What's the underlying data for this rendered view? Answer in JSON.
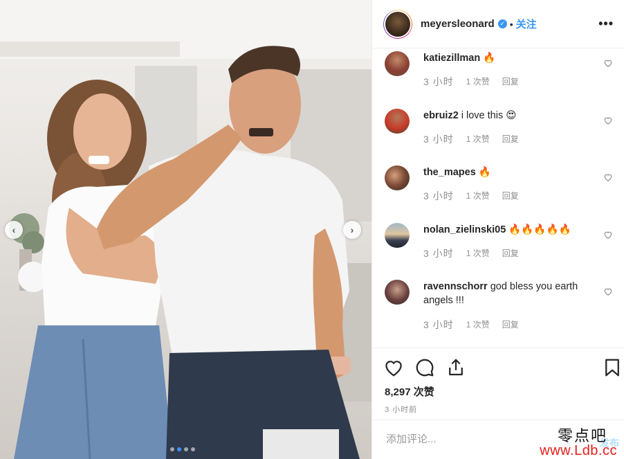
{
  "post": {
    "username": "meyersleonard",
    "verified_icon": "verified-badge-icon",
    "separator": "•",
    "follow_label": "关注",
    "more_label": "•••",
    "likes": "8,297 次赞",
    "posted_time": "3 小时前"
  },
  "comments": [
    {
      "user": "katiezillman",
      "text": "🔥",
      "time": "3 小时",
      "likes": "1 次赞",
      "reply": "回复"
    },
    {
      "user": "ebruiz2",
      "text": "i love this 😍",
      "time": "3 小时",
      "likes": "1 次赞",
      "reply": "回复"
    },
    {
      "user": "the_mapes",
      "text": "🔥",
      "time": "3 小时",
      "likes": "1 次赞",
      "reply": "回复"
    },
    {
      "user": "nolan_zielinski05",
      "text": "🔥🔥🔥🔥🔥",
      "time": "3 小时",
      "likes": "1 次赞",
      "reply": "回复"
    },
    {
      "user": "ravennschorr",
      "text": "god bless you earth angels !!!",
      "time": "3 小时",
      "likes": "1 次赞",
      "reply": "回复"
    }
  ],
  "add_comment": {
    "placeholder": "添加评论...",
    "publish_label": "发布"
  },
  "watermark": {
    "line1": "零点吧",
    "line2": "www.Ldb.cc"
  },
  "carousel": {
    "prev": "‹",
    "next": "›",
    "total_slides": 4,
    "active_slide": 2
  },
  "colors": {
    "link_blue": "#3897f0",
    "meta_gray": "#8e8e8e",
    "watermark_red": "#e0201b"
  }
}
